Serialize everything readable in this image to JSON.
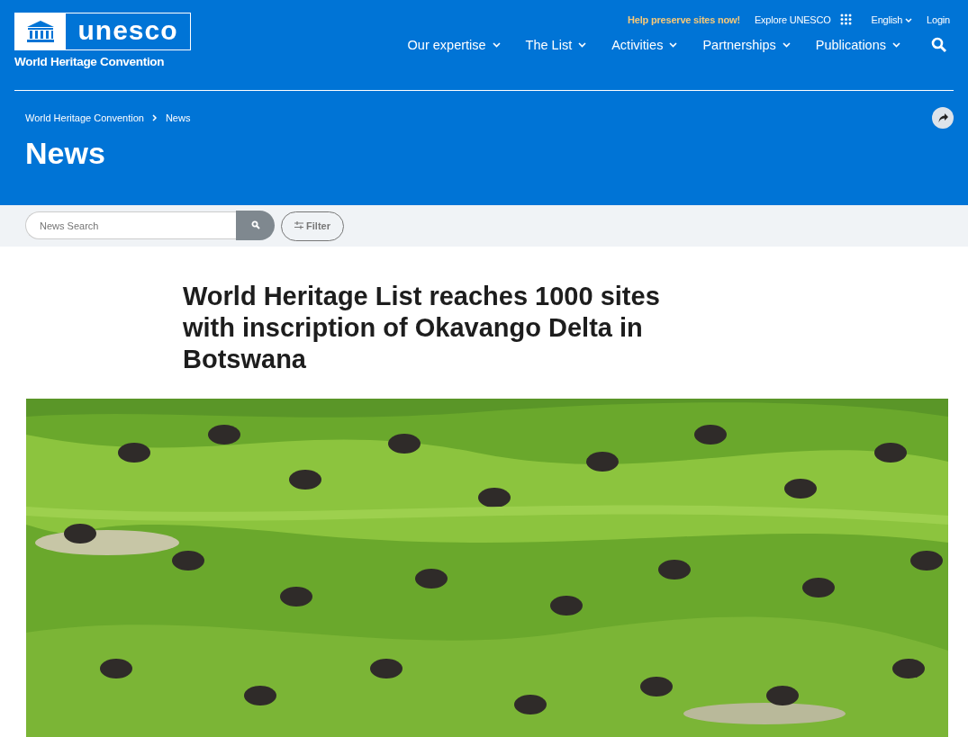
{
  "logo": {
    "wordmark": "unesco",
    "subtitle": "World Heritage Convention"
  },
  "top_links": [
    {
      "label": "Help preserve sites now!",
      "kind": "highlight"
    },
    {
      "label": "Explore UNESCO",
      "kind": "apps"
    },
    {
      "label": "English",
      "kind": "dropdown"
    },
    {
      "label": "Login",
      "kind": "plain"
    }
  ],
  "main_nav": [
    "Our expertise",
    "The List",
    "Activities",
    "Partnerships",
    "Publications"
  ],
  "breadcrumb": [
    "World Heritage Convention",
    "News"
  ],
  "page_title": "News",
  "search": {
    "placeholder": "News Search"
  },
  "filter_button": "Filter",
  "article": {
    "title": "World Heritage List reaches 1000 sites with inscription of Okavango Delta in Botswana"
  }
}
